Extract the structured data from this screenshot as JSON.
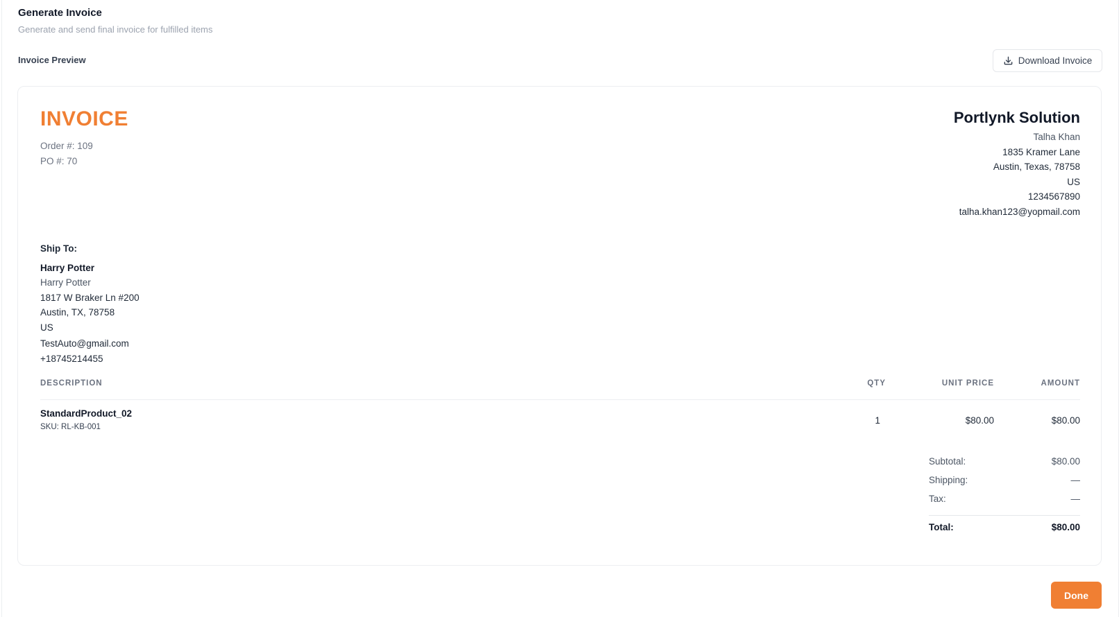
{
  "header": {
    "title": "Generate Invoice",
    "subtitle": "Generate and send final invoice for fulfilled items",
    "section_label": "Invoice Preview",
    "download_label": "Download Invoice",
    "download_icon": "download-icon"
  },
  "invoice": {
    "title": "INVOICE",
    "order_number": "Order #: 109",
    "po_number": "PO #: 70",
    "accent_color": "#f07f33"
  },
  "company": {
    "name": "Portlynk Solution",
    "contact": "Talha Khan",
    "street": "1835 Kramer Lane",
    "city_state_zip": "Austin, Texas, 78758",
    "country": "US",
    "phone": "1234567890",
    "email": "talha.khan123@yopmail.com"
  },
  "ship_to": {
    "label": "Ship To:",
    "name": "Harry Potter",
    "contact": "Harry Potter",
    "street": "1817 W Braker Ln #200",
    "city_state_zip": "Austin, TX, 78758",
    "country": "US",
    "email": "TestAuto@gmail.com",
    "phone": "+18745214455"
  },
  "table": {
    "headers": {
      "description": "DESCRIPTION",
      "qty": "QTY",
      "unit_price": "UNIT PRICE",
      "amount": "AMOUNT"
    },
    "rows": [
      {
        "product": "StandardProduct_02",
        "sku": "SKU: RL-KB-001",
        "qty": "1",
        "unit_price": "$80.00",
        "amount": "$80.00"
      }
    ]
  },
  "totals": {
    "subtotal_label": "Subtotal:",
    "subtotal_value": "$80.00",
    "shipping_label": "Shipping:",
    "shipping_value": "—",
    "tax_label": "Tax:",
    "tax_value": "—",
    "total_label": "Total:",
    "total_value": "$80.00"
  },
  "footer": {
    "done_label": "Done"
  }
}
